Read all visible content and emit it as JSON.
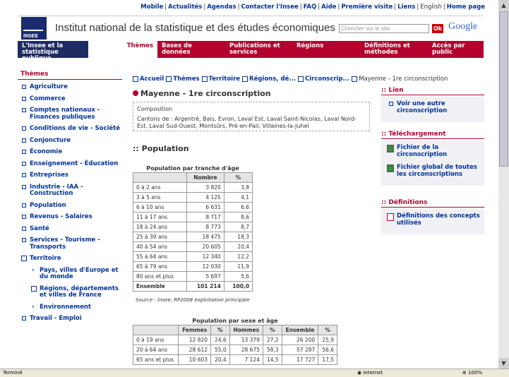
{
  "topnav": {
    "links": [
      "Mobile",
      "Actualités",
      "Agendas",
      "Contacter l'Insee",
      "FAQ",
      "Aide",
      "Première visite",
      "Liens"
    ],
    "english": "English",
    "home": "Home page"
  },
  "header": {
    "logo_text": "INSEE",
    "site_name": "Institut national de la statistique et des études économiques",
    "search_placeholder": "Chercher sur le site",
    "ok_label": "Ok",
    "google_label": "Google"
  },
  "menu": [
    "L'Insee et la statistique publique",
    "Thèmes",
    "Bases de données",
    "Publications et services",
    "Régions",
    "Définitions et méthodes",
    "Accès par public"
  ],
  "sidebar": {
    "heading": "Thèmes",
    "items": [
      "Agriculture",
      "Commerce",
      "Comptes nationaux - Finances publiques",
      "Conditions de vie - Société",
      "Conjoncture",
      "Économie",
      "Enseignement - Éducation",
      "Entreprises",
      "Industrie - IAA - Construction",
      "Population",
      "Revenus - Salaires",
      "Santé",
      "Services - Tourisme - Transports",
      "Territoire"
    ],
    "subitems": [
      "Pays, villes d'Europe et du monde",
      "Régions, départements et villes de France",
      "Environnement"
    ],
    "last_item": "Travail - Emploi"
  },
  "breadcrumb": {
    "items": [
      "Accueil",
      "Thèmes",
      "Territoire",
      "Régions, dé...",
      "Circonscrip...",
      "Mayenne - 1re circonscription"
    ]
  },
  "title": "Mayenne - 1re circonscription",
  "composition": {
    "label": "Composition",
    "text": "Cantons de : Argentré, Bais, Evron, Laval Est, Laval Saint-Nicolas, Laval Nord-Est, Laval Sud-Ouest, Montsûrs, Pré-en-Pail, Villaines-la-Juhel"
  },
  "population_heading": ":: Population",
  "table_age": {
    "caption": "Population par tranche d'âge",
    "headers": [
      "",
      "Nombre",
      "%"
    ],
    "rows": [
      [
        "0 à 2 ans",
        "3 820",
        "3,8"
      ],
      [
        "3 à 5 ans",
        "4 125",
        "4,1"
      ],
      [
        "6 à 10 ans",
        "6 631",
        "6,6"
      ],
      [
        "11 à 17 ans",
        "8 717",
        "8,6"
      ],
      [
        "18 à 24 ans",
        "8 773",
        "8,7"
      ],
      [
        "25 à 39 ans",
        "18 475",
        "18,3"
      ],
      [
        "40 à 54 ans",
        "20 605",
        "20,4"
      ],
      [
        "55 à 64 ans",
        "12 340",
        "12,2"
      ],
      [
        "65 à 79 ans",
        "12 030",
        "11,9"
      ],
      [
        "80 ans et plus",
        "5 697",
        "5,6"
      ],
      [
        "Ensemble",
        "101 214",
        "100,0"
      ]
    ],
    "source": "Source : Insee, RP2008 exploitation principale"
  },
  "table_sex": {
    "caption": "Population par sexe et âge",
    "headers": [
      "",
      "Femmes",
      "%",
      "Hommes",
      "%",
      "Ensemble",
      "%"
    ],
    "rows": [
      [
        "0 à 19 ans",
        "12 820",
        "24,6",
        "13 379",
        "27,2",
        "26 200",
        "25,9"
      ],
      [
        "20 à 64 ans",
        "28 612",
        "55,0",
        "28 675",
        "58,3",
        "57 287",
        "56,6"
      ],
      [
        "65 ans et plus",
        "10 603",
        "20,4",
        "7 124",
        "14,5",
        "17 727",
        "17,5"
      ]
    ]
  },
  "right": {
    "lien_heading": ":: Lien",
    "lien_item": "Voir une autre circonscription",
    "dl_heading": ":: Téléchargement",
    "dl_items": [
      "Fichier de la circonscription",
      "Fichier global de toutes les circonscriptions"
    ],
    "def_heading": ":: Définitions",
    "def_item": "Définitions des concepts utilisés"
  },
  "status": {
    "left": "Terminé",
    "zone": "Internet",
    "zoom": "100%"
  }
}
